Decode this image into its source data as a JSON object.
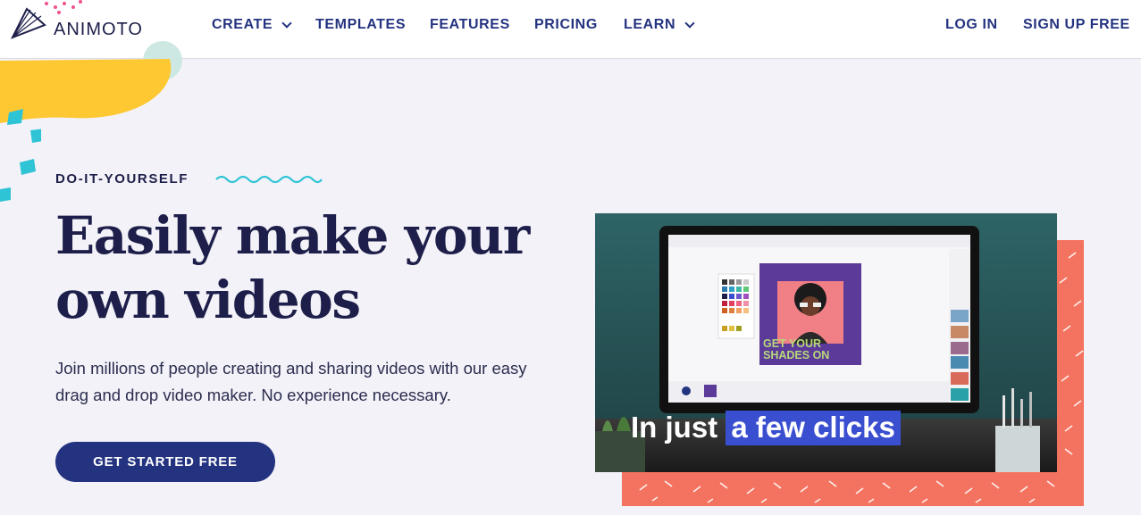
{
  "header": {
    "logo_text": "ANIMOTO",
    "nav": [
      {
        "label": "CREATE",
        "has_dropdown": true
      },
      {
        "label": "TEMPLATES",
        "has_dropdown": false
      },
      {
        "label": "FEATURES",
        "has_dropdown": false
      },
      {
        "label": "PRICING",
        "has_dropdown": false
      },
      {
        "label": "LEARN",
        "has_dropdown": true
      }
    ],
    "log_in": "LOG IN",
    "sign_up": "SIGN UP FREE"
  },
  "hero": {
    "eyebrow": "DO-IT-YOURSELF",
    "headline_line1": "Easily make your",
    "headline_line2": "own videos",
    "subtext": "Join millions of people creating and sharing videos with our easy drag and drop video maker. No experience necessary.",
    "cta_label": "GET STARTED FREE"
  },
  "video": {
    "caption_plain": "In just",
    "caption_highlight": "a few clicks",
    "poster_text_line1": "GET YOUR",
    "poster_text_line2": "SHADES ON"
  },
  "colors": {
    "navy": "#243380",
    "ink": "#1d1f4a",
    "background": "#f3f2f8",
    "coral": "#f47360",
    "teal_accent": "#2ec4d6",
    "yellow_accent": "#fdc832",
    "highlight_blue": "#3a4fd0"
  }
}
